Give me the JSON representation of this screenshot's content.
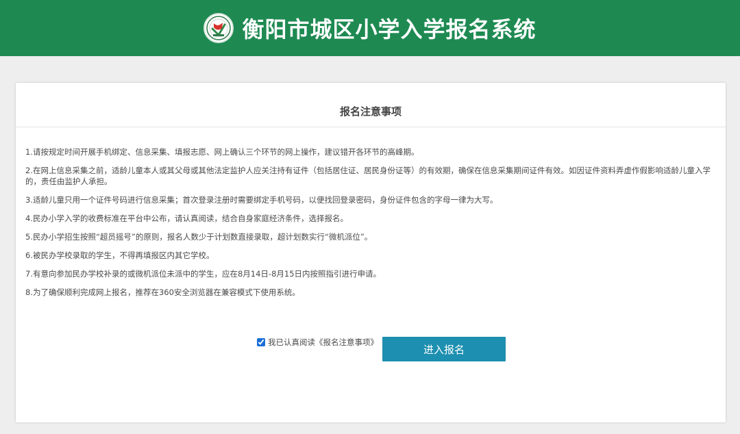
{
  "header": {
    "title": "衡阳市城区小学入学报名系统",
    "logo_icon": "school-emblem-icon",
    "background_color": "#1e8a52"
  },
  "notice": {
    "title": "报名注意事项",
    "items": [
      "1.请按规定时间开展手机绑定、信息采集、填报志愿、网上确认三个环节的网上操作，建议错开各环节的高峰期。",
      "2.在网上信息采集之前，适龄儿童本人或其父母或其他法定监护人应关注持有证件（包括居住证、居民身份证等）的有效期，确保在信息采集期间证件有效。如因证件资料弄虚作假影响适龄儿童入学的，责任由监护人承担。",
      "3.适龄儿童只用一个证件号码进行信息采集；首次登录注册时需要绑定手机号码，以便找回登录密码，身份证件包含的字母一律为大写。",
      "4.民办小学入学的收费标准在平台中公布，请认真阅读，结合自身家庭经济条件，选择报名。",
      "5.民办小学招生按照“超员摇号”的原则，报名人数少于计划数直接录取，超计划数实行“微机派位”。",
      "6.被民办学校录取的学生，不得再填报区内其它学校。",
      "7.有意向参加民办学校补录的或微机派位未派中的学生，应在8月14日-8月15日内按照指引进行申请。",
      "8.为了确保顺利完成网上报名，推荐在360安全浏览器在兼容模式下使用系统。"
    ]
  },
  "agreement": {
    "label": "我已认真阅读《报名注意事项》",
    "checked": true
  },
  "actions": {
    "enter_label": "进入报名",
    "button_color": "#1d8fb0"
  }
}
